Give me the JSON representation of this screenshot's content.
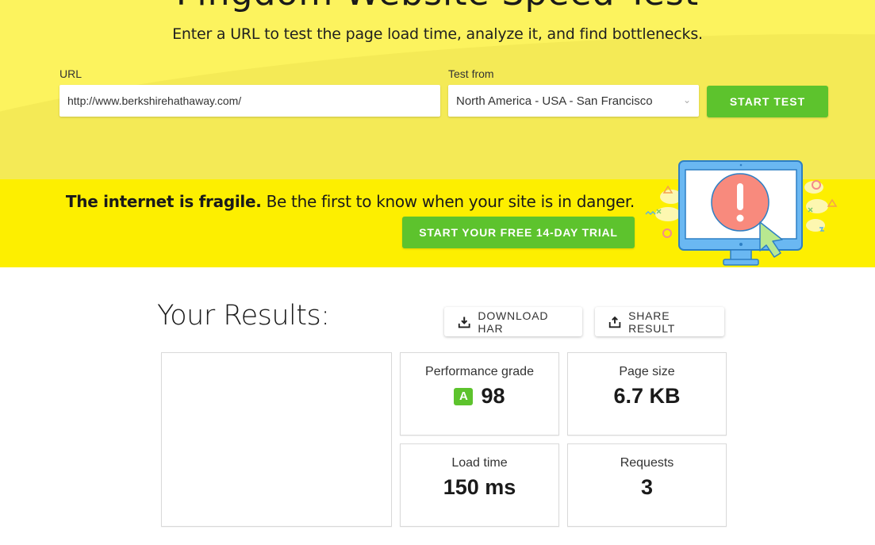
{
  "hero": {
    "heading": "Pingdom Website Speed Test",
    "subtitle": "Enter a URL to test the page load time, analyze it, and find bottlenecks.",
    "url_label": "URL",
    "url_value": "http://www.berkshirehathaway.com/",
    "test_from_label": "Test from",
    "test_from_value": "North America - USA - San Francisco",
    "start_test_label": "START TEST"
  },
  "banner": {
    "bold_text": "The internet is fragile.",
    "text": " Be the first to know when your site is in danger.",
    "trial_button_label": "START YOUR FREE 14-DAY TRIAL",
    "illustration": "monitor-alert-icon"
  },
  "results": {
    "title": "Your Results:",
    "download_label": "DOWNLOAD HAR",
    "download_icon": "download-icon",
    "share_label": "SHARE RESULT",
    "share_icon": "share-icon",
    "metrics": [
      {
        "label": "Performance grade",
        "grade": "A",
        "value": "98"
      },
      {
        "label": "Page size",
        "value": "6.7 KB"
      },
      {
        "label": "Load time",
        "value": "150 ms"
      },
      {
        "label": "Requests",
        "value": "3"
      }
    ]
  },
  "colors": {
    "hero_bg": "#fcf35e",
    "banner_bg": "#fdef00",
    "accent_green": "#5dc32d",
    "alert_red": "#f88a7d",
    "monitor_blue": "#6ab8f2"
  }
}
